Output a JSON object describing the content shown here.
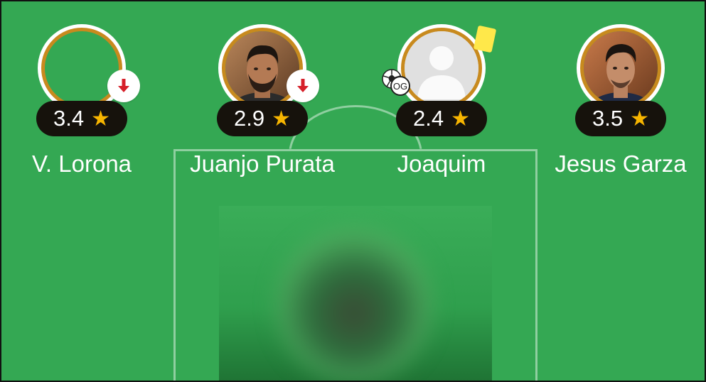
{
  "players": [
    {
      "name": "V. Lorona",
      "rating": "3.4",
      "substituted": true,
      "yellow_card": false,
      "own_goal": false,
      "photo": "empty"
    },
    {
      "name": "Juanjo Purata",
      "rating": "2.9",
      "substituted": true,
      "yellow_card": false,
      "own_goal": false,
      "photo": "player-photo"
    },
    {
      "name": "Joaquim",
      "rating": "2.4",
      "substituted": false,
      "yellow_card": true,
      "own_goal": true,
      "own_goal_label": "OG",
      "photo": "placeholder-person"
    },
    {
      "name": "Jesus Garza",
      "rating": "3.5",
      "substituted": false,
      "yellow_card": false,
      "own_goal": false,
      "photo": "player-photo"
    }
  ],
  "colors": {
    "pitch": "#34a853",
    "ring": "#c88a1e",
    "rating_bg": "#16120c",
    "star": "#f7b500",
    "sub_arrow": "#d6202a",
    "yellow_card": "#ffe84a"
  },
  "icons": {
    "rating": "star-icon",
    "substitution": "arrow-down-icon",
    "booking": "yellow-card-icon",
    "own_goal": "soccer-ball-icon"
  }
}
